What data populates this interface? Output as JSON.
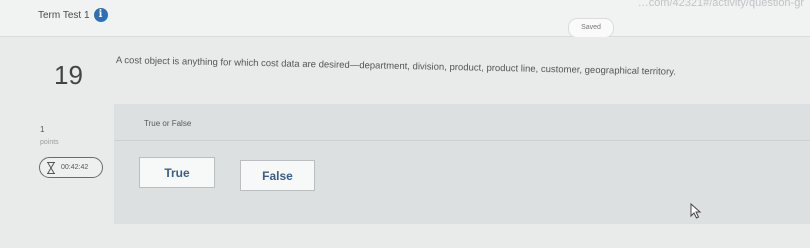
{
  "header": {
    "url_fragment": "…com/42321#/activity/question-gr",
    "assignment_title": "Term Test 1",
    "info_icon": "info-circle-icon",
    "saved_label": "Saved"
  },
  "question": {
    "number": "19",
    "text": "A cost object is anything for which cost data are desired—department, division, product, product line, customer, geographical territory.",
    "type_label": "True or False",
    "points_value": "1",
    "points_label": "points",
    "timer": "00:42:42",
    "options": [
      {
        "label": "True"
      },
      {
        "label": "False"
      }
    ]
  },
  "colors": {
    "accent": "#2f6fb5",
    "choice_text": "#3a5f86",
    "background": "#e6e8e8"
  }
}
